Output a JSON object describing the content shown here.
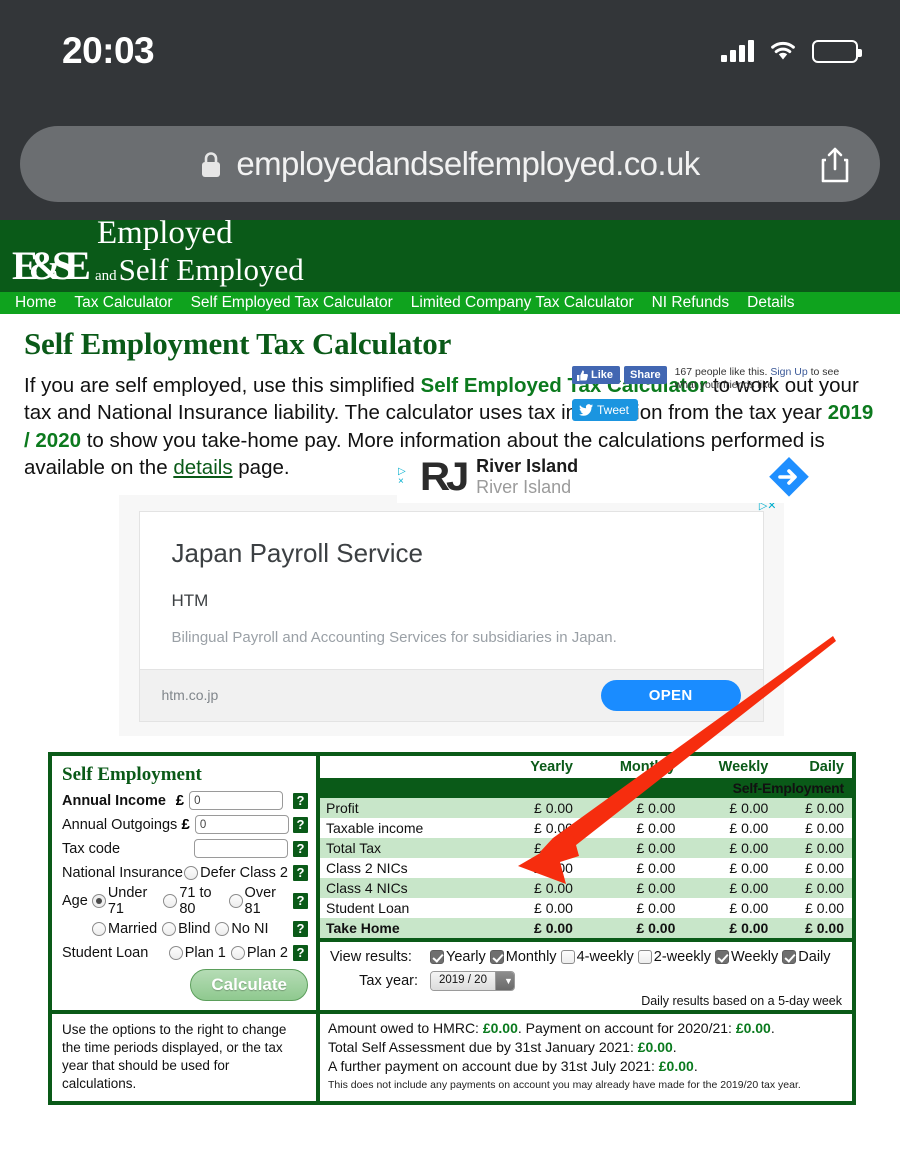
{
  "status_bar": {
    "time": "20:03",
    "cell_icon": "cellular-bars-icon",
    "wifi_icon": "wifi-icon",
    "battery_icon": "battery-icon"
  },
  "browser": {
    "lock_icon": "lock-icon",
    "url": "employedandselfemployed.co.uk",
    "share_icon": "share-icon"
  },
  "site_header": {
    "logo_mark": "E&SE",
    "logo_word1": "Employed",
    "logo_and": "and",
    "logo_word2": "Self Employed"
  },
  "banner_ad": {
    "adchoices_icon": "adchoices-icon",
    "close_icon": "close-icon",
    "brand_mark": "RJ",
    "title": "River Island",
    "subtitle": "River Island",
    "cta_icon": "arrow-right-diamond-icon"
  },
  "nav": {
    "items": [
      {
        "label": "Home"
      },
      {
        "label": "Tax Calculator"
      },
      {
        "label": "Self Employed Tax Calculator"
      },
      {
        "label": "Limited Company Tax Calculator"
      },
      {
        "label": "NI Refunds"
      },
      {
        "label": "Details"
      }
    ]
  },
  "main": {
    "page_title": "Self Employment Tax Calculator",
    "intro": {
      "p1": "If you are self employed, use this simplified ",
      "b1": "Self Employed Tax Calculator",
      "p2": " to work out your tax and National Insurance liability. The calculator uses tax information from the tax year ",
      "b2": "2019 / 2020",
      "p3": " to show you take-home pay. More information about the calculations performed is available on the ",
      "link": "details",
      "p4": " page."
    }
  },
  "social": {
    "like_label": "Like",
    "like_icon": "thumbs-up-icon",
    "share_label": "Share",
    "note_count": "167 people like this.",
    "note_signup": "Sign Up",
    "note_rest": " to see what your friends like.",
    "tweet_label": "Tweet",
    "tweet_icon": "twitter-bird-icon"
  },
  "ad_card": {
    "adchoices": "adchoices-icon",
    "title": "Japan Payroll Service",
    "brand": "HTM",
    "description": "Bilingual Payroll and Accounting Services for subsidiaries in Japan.",
    "url": "htm.co.jp",
    "open_label": "OPEN"
  },
  "form": {
    "heading": "Self Employment",
    "annual_income_label": "Annual Income",
    "annual_income_currency": "£",
    "annual_income_value": "0",
    "annual_outgoings_label": "Annual Outgoings",
    "annual_outgoings_currency": "£",
    "annual_outgoings_value": "0",
    "tax_code_label": "Tax code",
    "tax_code_value": "",
    "national_insurance_label": "National Insurance",
    "defer_class2_label": "Defer Class 2",
    "age_label": "Age",
    "age_options": [
      {
        "label": "Under 71",
        "selected": true
      },
      {
        "label": "71 to 80",
        "selected": false
      },
      {
        "label": "Over 81",
        "selected": false
      }
    ],
    "married_label": "Married",
    "blind_label": "Blind",
    "no_ni_label": "No NI",
    "student_loan_label": "Student Loan",
    "plan1_label": "Plan 1",
    "plan2_label": "Plan 2",
    "calculate_label": "Calculate",
    "help_glyph": "?"
  },
  "results": {
    "columns": [
      "Yearly",
      "Monthly",
      "Weekly",
      "Daily"
    ],
    "band_title": "Self-Employment",
    "rows": [
      {
        "label": "Profit",
        "values": [
          "£ 0.00",
          "£ 0.00",
          "£ 0.00",
          "£ 0.00"
        ]
      },
      {
        "label": "Taxable income",
        "values": [
          "£ 0.00",
          "£ 0.00",
          "£ 0.00",
          "£ 0.00"
        ]
      },
      {
        "label": "Total Tax",
        "values": [
          "£ 0.00",
          "£ 0.00",
          "£ 0.00",
          "£ 0.00"
        ]
      },
      {
        "label": "Class 2 NICs",
        "values": [
          "£ 0.00",
          "£ 0.00",
          "£ 0.00",
          "£ 0.00"
        ]
      },
      {
        "label": "Class 4 NICs",
        "values": [
          "£ 0.00",
          "£ 0.00",
          "£ 0.00",
          "£ 0.00"
        ]
      },
      {
        "label": "Student Loan",
        "values": [
          "£ 0.00",
          "£ 0.00",
          "£ 0.00",
          "£ 0.00"
        ]
      },
      {
        "label": "Take Home",
        "values": [
          "£ 0.00",
          "£ 0.00",
          "£ 0.00",
          "£ 0.00"
        ]
      }
    ]
  },
  "view_options": {
    "label": "View results:",
    "checkboxes": [
      {
        "label": "Yearly",
        "checked": true
      },
      {
        "label": "Monthly",
        "checked": true
      },
      {
        "label": "4-weekly",
        "checked": false
      },
      {
        "label": "2-weekly",
        "checked": false
      },
      {
        "label": "Weekly",
        "checked": true
      },
      {
        "label": "Daily",
        "checked": true
      }
    ],
    "tax_year_label": "Tax year:",
    "tax_year_value": "2019 / 20",
    "tax_year_options": [
      "2019 / 20"
    ],
    "daily_note": "Daily results based on a 5-day week"
  },
  "bottom": {
    "hint": "Use the options to the right to change the time periods displayed, or the tax year that should be used for calculations.",
    "line1_a": "Amount owed to HMRC: ",
    "line1_v1": "£0.00",
    "line1_b": ". Payment on account for 2020/21: ",
    "line1_v2": "£0.00",
    "line1_c": ".",
    "line2_a": "Total Self Assessment due by 31st January 2021: ",
    "line2_v": "£0.00",
    "line2_b": ".",
    "line3_a": "A further payment on account due by 31st July 2021: ",
    "line3_v": "£0.00",
    "line3_b": ".",
    "fine": "This does not include any payments on account you may already have made for the 2019/20 tax year."
  },
  "annotation": {
    "arrow_color": "#f62d0e",
    "arrow_name": "red-annotation-arrow"
  },
  "colors": {
    "brand_dark_green": "#0a5a18",
    "nav_green": "#0fa31e",
    "row_green": "#c8e6c9",
    "accent_blue": "#1a8cff"
  }
}
